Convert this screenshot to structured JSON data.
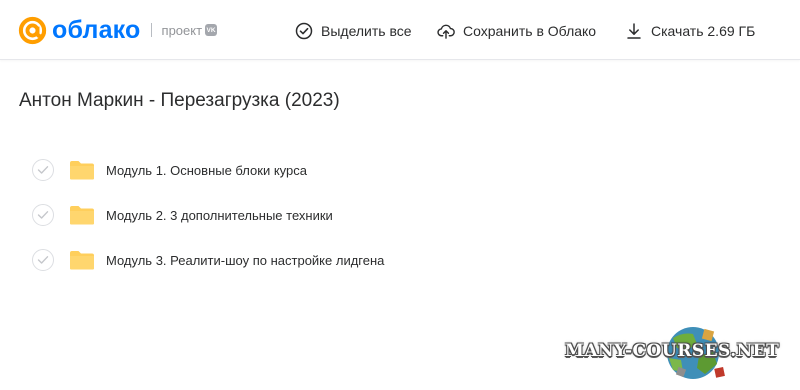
{
  "header": {
    "logo_text": "облако",
    "project_label": "проект",
    "vk_badge": "VK",
    "actions": [
      {
        "label": "Выделить все",
        "icon": "check-circle-icon"
      },
      {
        "label": "Сохранить в Облако",
        "icon": "cloud-upload-icon"
      },
      {
        "label": "Скачать 2.69 ГБ",
        "icon": "download-icon"
      }
    ]
  },
  "main": {
    "title": "Антон Маркин - Перезагрузка (2023)",
    "items": [
      {
        "name": "Модуль 1. Основные блоки курса",
        "icon": "folder-icon"
      },
      {
        "name": "Модуль 2. 3 дополнительные техники",
        "icon": "folder-icon"
      },
      {
        "name": "Модуль 3. Реалити-шоу по настройке лидгена",
        "icon": "folder-icon"
      }
    ]
  },
  "watermark": {
    "text": "MANY-COURSES.NET"
  },
  "colors": {
    "brand_blue": "#0077ff",
    "brand_orange": "#ff9e00",
    "folder_yellow": "#ffcf5c",
    "text": "#2c2d2e"
  }
}
